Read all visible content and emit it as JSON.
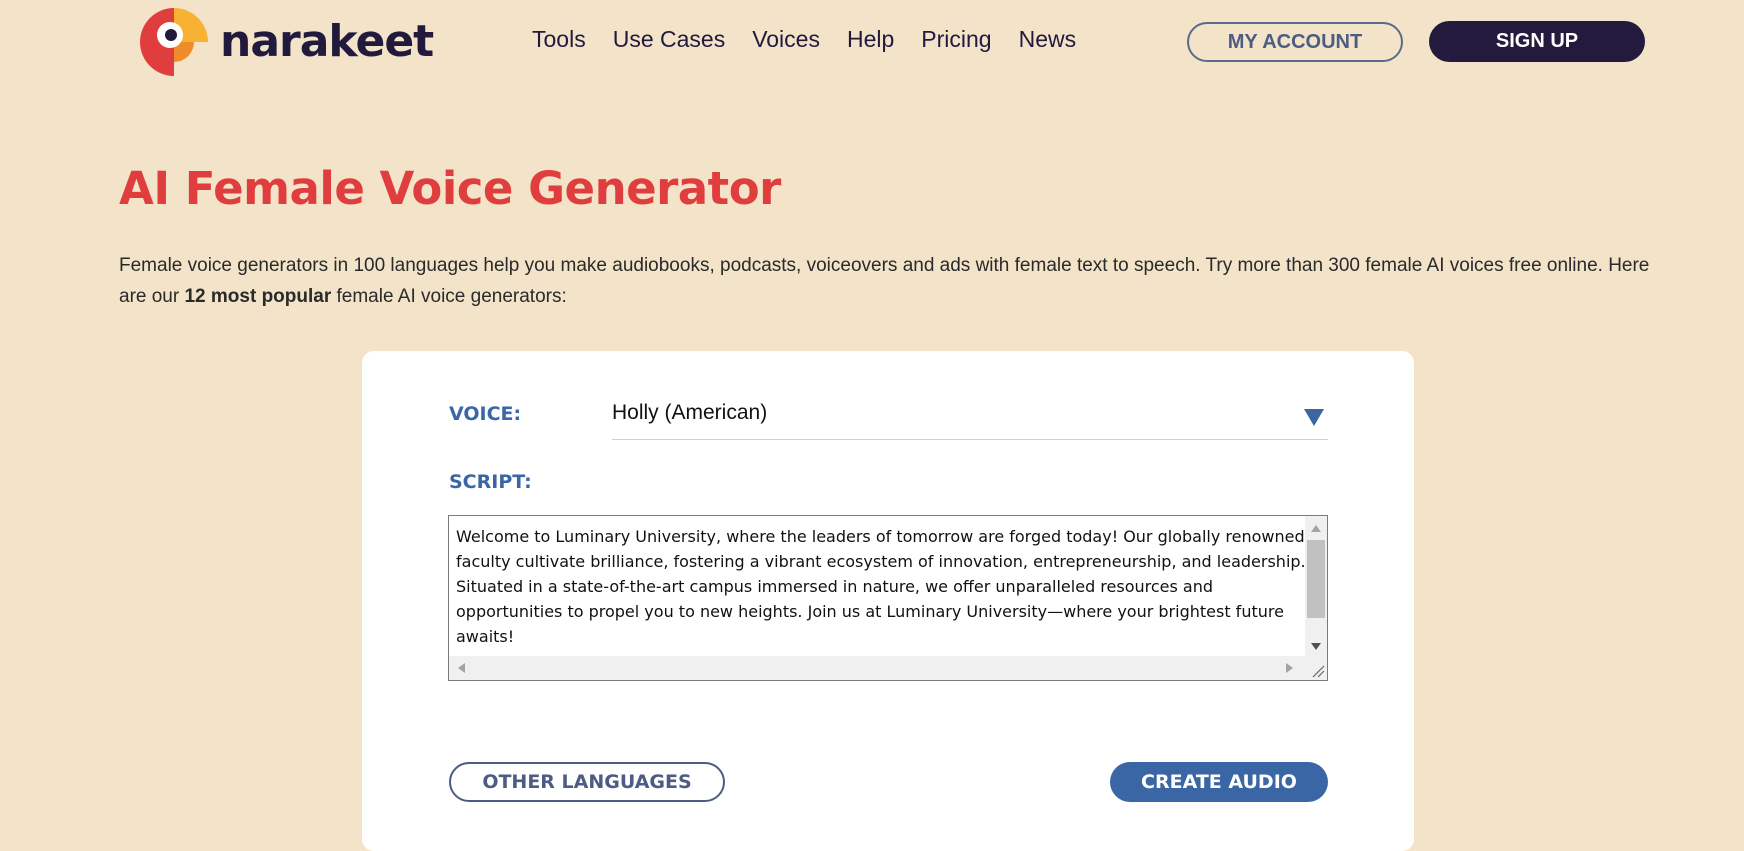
{
  "colors": {
    "background": "#f2e3c9",
    "brand_dark": "#211a3d",
    "accent_red": "#e03e3e",
    "accent_blue": "#3a66a6"
  },
  "header": {
    "logo_text": "narakeet",
    "logo_icon": "parrot-logo-icon",
    "nav": [
      "Tools",
      "Use Cases",
      "Voices",
      "Help",
      "Pricing",
      "News"
    ],
    "my_account_label": "MY ACCOUNT",
    "sign_up_label": "SIGN UP"
  },
  "main": {
    "title": "AI Female Voice Generator",
    "intro_before": "Female voice generators in 100 languages help you make audiobooks, podcasts, voiceovers and ads with female text to speech. Try more than 300 female AI voices free online. Here are our ",
    "intro_bold": "12 most popular",
    "intro_after": " female AI voice generators:"
  },
  "form": {
    "voice_label": "VOICE:",
    "voice_value": "Holly (American)",
    "voice_arrow_icon": "dropdown-triangle-icon",
    "script_label": "SCRIPT:",
    "script_text": "Welcome to Luminary University, where the leaders of tomorrow are forged today! Our globally renowned faculty cultivate brilliance, fostering a vibrant ecosystem of innovation, entrepreneurship, and leadership. Situated in a state-of-the-art campus immersed in nature, we offer unparalleled resources and opportunities to propel you to new heights. Join us at Luminary University—where your brightest future awaits!",
    "other_languages_label": "OTHER LANGUAGES",
    "create_audio_label": "CREATE AUDIO"
  }
}
